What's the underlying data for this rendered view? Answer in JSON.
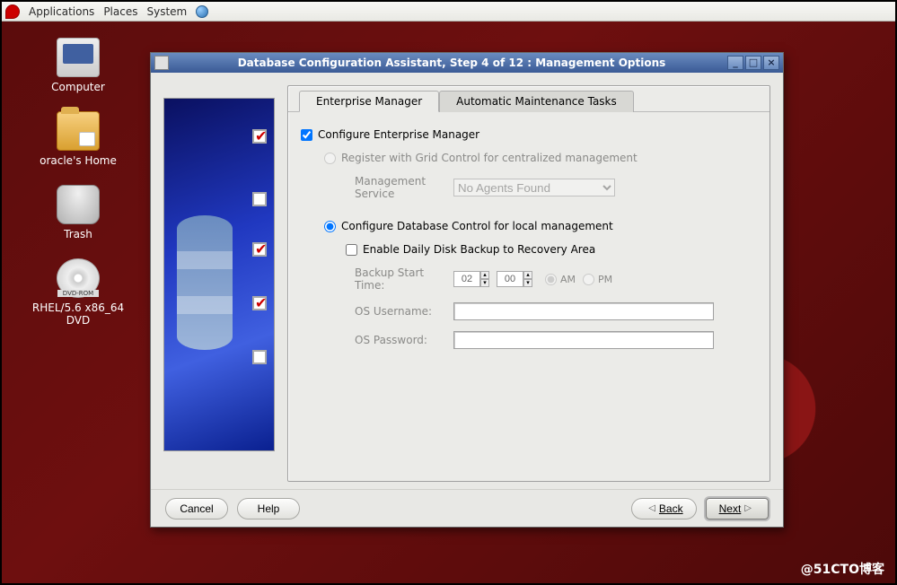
{
  "panel": {
    "menu": {
      "applications": "Applications",
      "places": "Places",
      "system": "System"
    }
  },
  "desktop": {
    "computer": "Computer",
    "home": "oracle's Home",
    "trash": "Trash",
    "dvd": "RHEL/5.6 x86_64\nDVD",
    "dvd_badge": "DVD-ROM"
  },
  "window": {
    "title": "Database Configuration Assistant, Step 4 of 12 : Management Options"
  },
  "tabs": {
    "em": "Enterprise Manager",
    "amt": "Automatic Maintenance Tasks"
  },
  "form": {
    "configure_em": "Configure Enterprise Manager",
    "register_grid": "Register with Grid Control for centralized management",
    "mgmt_service_label": "Management Service",
    "mgmt_service_value": "No Agents Found",
    "configure_dbcontrol": "Configure Database Control for local management",
    "enable_backup": "Enable Daily Disk Backup to Recovery Area",
    "backup_time_label": "Backup Start Time:",
    "backup_hour": "02",
    "backup_min": "00",
    "am": "AM",
    "pm": "PM",
    "os_user_label": "OS Username:",
    "os_pass_label": "OS Password:"
  },
  "buttons": {
    "cancel": "Cancel",
    "help": "Help",
    "back": "Back",
    "next": "Next"
  },
  "watermark": "@51CTO博客"
}
